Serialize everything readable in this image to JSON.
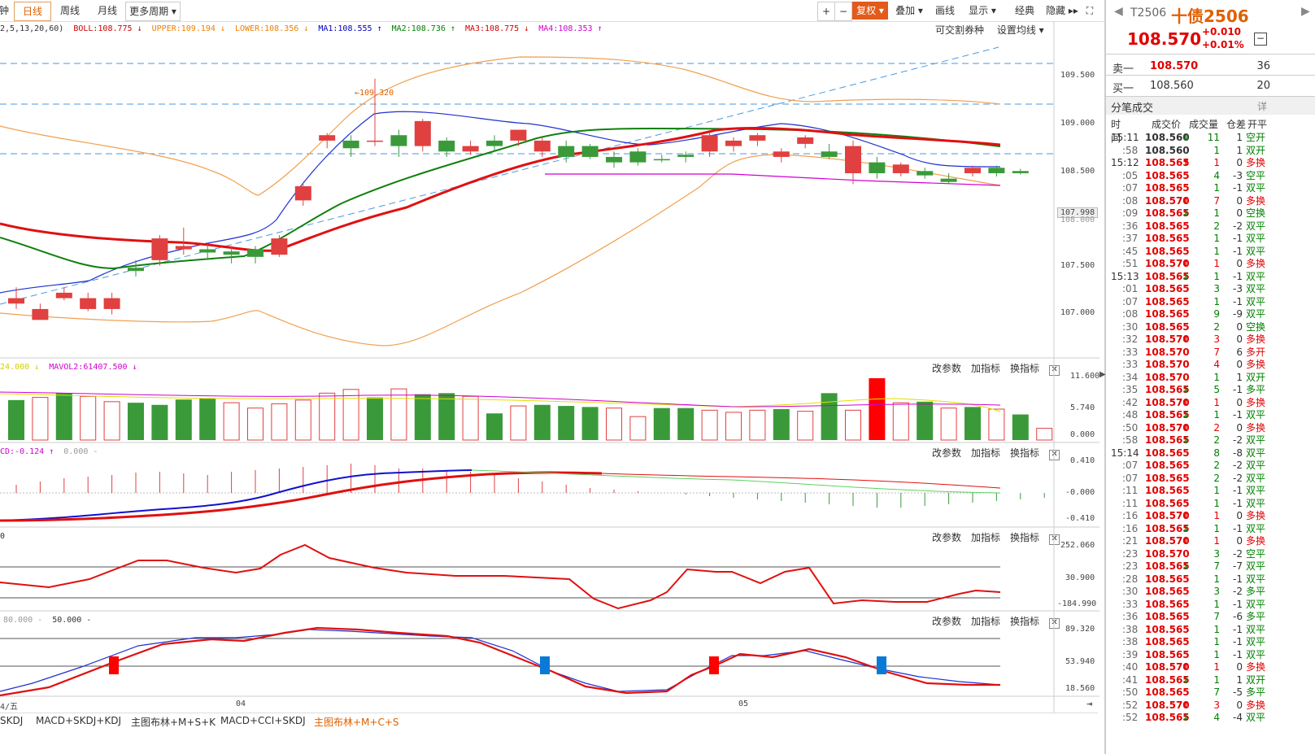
{
  "toolbar": {
    "tabs": [
      "钟",
      "日线",
      "周线",
      "月线",
      "更多周期 ▾"
    ],
    "active_tab": "日线",
    "right_buttons": [
      "+",
      "−",
      "复权 ▾",
      "叠加 ▾",
      "画线",
      "显示 ▾",
      "经典",
      "隐藏 ▸▸",
      "⛶"
    ]
  },
  "main_legend": {
    "params": "2,5,13,20,60)",
    "boll": "BOLL:108.775 ↓",
    "upper": "UPPER:109.194 ↓",
    "lower": "LOWER:108.356 ↓",
    "ma1": "MA1:108.555 ↑",
    "ma2": "MA2:108.736 ↑",
    "ma3": "MA3:108.775 ↓",
    "ma4": "MA4:108.353 ↑",
    "right1": "可交割券种",
    "right2": "设置均线 ▾"
  },
  "main_axis": [
    "109.500",
    "109.000",
    "108.500",
    "107.998",
    "108.000",
    "107.500",
    "107.000"
  ],
  "high_marker": "←109.320",
  "vol_legend": {
    "a": "24.000 ↓",
    "b": "MAVOL2:61407.500 ↓"
  },
  "vol_axis": [
    "11.600",
    "5.740",
    "0.000"
  ],
  "macd_legend": {
    "a": "CD:-0.124 ↑",
    "b": "0.000 -"
  },
  "macd_axis": [
    "0.410",
    "-0.000",
    "-0.410"
  ],
  "cci_legend": {
    "a": "0"
  },
  "cci_axis": [
    "252.060",
    "30.900",
    "-184.990"
  ],
  "kdj_legend": {
    "a": "80.000 -",
    "b": "50.000 -"
  },
  "kdj_axis": [
    "89.320",
    "53.940",
    "18.560"
  ],
  "sub_buttons": [
    "改参数",
    "加指标",
    "换指标"
  ],
  "date_labels": [
    "4/五",
    "04",
    "05"
  ],
  "bottom_tabs": [
    "SKDJ",
    "MACD+SKDJ+KDJ",
    "主图布林+M+S+K",
    "MACD+CCI+SKDJ",
    "主图布林+M+C+S"
  ],
  "active_bottom_tab": "主图布林+M+C+S",
  "quote": {
    "code": "T2506",
    "name": "十债2506",
    "price": "108.570",
    "change": "+0.010",
    "pct": "+0.01%",
    "sell_label": "卖一",
    "sell_price": "108.570",
    "sell_vol": "36",
    "buy_label": "买一",
    "buy_price": "108.560",
    "buy_vol": "20",
    "section": "分笔成交",
    "detail": "详",
    "headers": [
      "时间",
      "成交价",
      "成交量",
      "仓差",
      "开平"
    ]
  },
  "ticks": [
    [
      "15:11",
      "108.560",
      "↓",
      "11",
      "1",
      "空开",
      "g"
    ],
    [
      ":58",
      "108.560",
      "",
      "1",
      "1",
      "双开",
      "g"
    ],
    [
      "15:12",
      "108.565",
      "↑",
      "1",
      "0",
      "多换",
      "r"
    ],
    [
      ":05",
      "108.565",
      "",
      "4",
      "-3",
      "空平",
      "g"
    ],
    [
      ":07",
      "108.565",
      "",
      "1",
      "-1",
      "双平",
      "g"
    ],
    [
      ":08",
      "108.570",
      "↑",
      "7",
      "0",
      "多换",
      "r"
    ],
    [
      ":09",
      "108.565",
      "↓",
      "1",
      "0",
      "空换",
      "g"
    ],
    [
      ":36",
      "108.565",
      "",
      "2",
      "-2",
      "双平",
      "g"
    ],
    [
      ":37",
      "108.565",
      "",
      "1",
      "-1",
      "双平",
      "g"
    ],
    [
      ":45",
      "108.565",
      "",
      "1",
      "-1",
      "双平",
      "g"
    ],
    [
      ":51",
      "108.570",
      "↑",
      "1",
      "0",
      "多换",
      "r"
    ],
    [
      "15:13",
      "108.565",
      "↓",
      "1",
      "-1",
      "双平",
      "g"
    ],
    [
      ":01",
      "108.565",
      "",
      "3",
      "-3",
      "双平",
      "g"
    ],
    [
      ":07",
      "108.565",
      "",
      "1",
      "-1",
      "双平",
      "g"
    ],
    [
      ":08",
      "108.565",
      "",
      "9",
      "-9",
      "双平",
      "g"
    ],
    [
      ":30",
      "108.565",
      "",
      "2",
      "0",
      "空换",
      "g"
    ],
    [
      ":32",
      "108.570",
      "↑",
      "3",
      "0",
      "多换",
      "r"
    ],
    [
      ":33",
      "108.570",
      "",
      "7",
      "6",
      "多开",
      "r"
    ],
    [
      ":33",
      "108.570",
      "",
      "4",
      "0",
      "多换",
      "r"
    ],
    [
      ":34",
      "108.570",
      "",
      "1",
      "1",
      "双开",
      "g"
    ],
    [
      ":35",
      "108.565",
      "↓",
      "5",
      "-1",
      "多平",
      "g"
    ],
    [
      ":42",
      "108.570",
      "↑",
      "1",
      "0",
      "多换",
      "r"
    ],
    [
      ":48",
      "108.565",
      "↓",
      "1",
      "-1",
      "双平",
      "g"
    ],
    [
      ":50",
      "108.570",
      "↑",
      "2",
      "0",
      "多换",
      "r"
    ],
    [
      ":58",
      "108.565",
      "↓",
      "2",
      "-2",
      "双平",
      "g"
    ],
    [
      "15:14",
      "108.565",
      "",
      "8",
      "-8",
      "双平",
      "g"
    ],
    [
      ":07",
      "108.565",
      "",
      "2",
      "-2",
      "双平",
      "g"
    ],
    [
      ":07",
      "108.565",
      "",
      "2",
      "-2",
      "双平",
      "g"
    ],
    [
      ":11",
      "108.565",
      "",
      "1",
      "-1",
      "双平",
      "g"
    ],
    [
      ":11",
      "108.565",
      "",
      "1",
      "-1",
      "双平",
      "g"
    ],
    [
      ":16",
      "108.570",
      "↑",
      "1",
      "0",
      "多换",
      "r"
    ],
    [
      ":16",
      "108.565",
      "↓",
      "1",
      "-1",
      "双平",
      "g"
    ],
    [
      ":21",
      "108.570",
      "↑",
      "1",
      "0",
      "多换",
      "r"
    ],
    [
      ":23",
      "108.570",
      "",
      "3",
      "-2",
      "空平",
      "g"
    ],
    [
      ":23",
      "108.565",
      "↓",
      "7",
      "-7",
      "双平",
      "g"
    ],
    [
      ":28",
      "108.565",
      "",
      "1",
      "-1",
      "双平",
      "g"
    ],
    [
      ":30",
      "108.565",
      "",
      "3",
      "-2",
      "多平",
      "g"
    ],
    [
      ":33",
      "108.565",
      "",
      "1",
      "-1",
      "双平",
      "g"
    ],
    [
      ":36",
      "108.565",
      "",
      "7",
      "-6",
      "多平",
      "g"
    ],
    [
      ":38",
      "108.565",
      "",
      "1",
      "-1",
      "双平",
      "g"
    ],
    [
      ":38",
      "108.565",
      "",
      "1",
      "-1",
      "双平",
      "g"
    ],
    [
      ":39",
      "108.565",
      "",
      "1",
      "-1",
      "双平",
      "g"
    ],
    [
      ":40",
      "108.570",
      "↑",
      "1",
      "0",
      "多换",
      "r"
    ],
    [
      ":41",
      "108.565",
      "↓",
      "1",
      "1",
      "双开",
      "g"
    ],
    [
      ":50",
      "108.565",
      "",
      "7",
      "-5",
      "多平",
      "g"
    ],
    [
      ":52",
      "108.570",
      "↑",
      "3",
      "0",
      "多换",
      "r"
    ],
    [
      ":52",
      "108.565",
      "↓",
      "4",
      "-4",
      "双平",
      "g"
    ]
  ],
  "chart_data": [
    {
      "type": "candlestick",
      "title": "T2506 日线",
      "ylim": [
        106.9,
        109.7
      ],
      "candles": [
        [
          107.25,
          107.3,
          107.2,
          107.4
        ],
        [
          107.1,
          107.2,
          107.1,
          107.25
        ],
        [
          107.3,
          107.35,
          107.28,
          107.4
        ],
        [
          107.2,
          107.3,
          107.18,
          107.35
        ],
        [
          107.2,
          107.3,
          107.15,
          107.35
        ],
        [
          107.58,
          107.55,
          107.5,
          107.65
        ],
        [
          107.65,
          107.85,
          107.6,
          107.88
        ],
        [
          107.75,
          107.78,
          107.7,
          107.95
        ],
        [
          107.75,
          107.72,
          107.65,
          107.8
        ],
        [
          107.73,
          107.7,
          107.62,
          107.78
        ],
        [
          107.75,
          107.68,
          107.62,
          107.78
        ],
        [
          107.7,
          107.85,
          107.68,
          107.88
        ],
        [
          108.2,
          108.33,
          108.15,
          108.35
        ],
        [
          108.75,
          108.8,
          108.68,
          108.82
        ],
        [
          108.75,
          108.68,
          108.6,
          108.8
        ],
        [
          108.75,
          108.75,
          108.7,
          109.32
        ],
        [
          108.8,
          108.7,
          108.6,
          108.85
        ],
        [
          108.7,
          108.93,
          108.65,
          108.95
        ],
        [
          108.75,
          108.65,
          108.6,
          108.78
        ],
        [
          108.65,
          108.7,
          108.62,
          108.75
        ],
        [
          108.75,
          108.7,
          108.65,
          108.8
        ],
        [
          108.75,
          108.85,
          108.7,
          108.85
        ],
        [
          108.65,
          108.75,
          108.6,
          108.78
        ],
        [
          108.7,
          108.6,
          108.55,
          108.75
        ],
        [
          108.7,
          108.6,
          108.58,
          108.72
        ],
        [
          108.6,
          108.55,
          108.5,
          108.65
        ],
        [
          108.65,
          108.55,
          108.52,
          108.68
        ],
        [
          108.58,
          108.57,
          108.55,
          108.62
        ],
        [
          108.62,
          108.6,
          108.55,
          108.65
        ],
        [
          108.65,
          108.8,
          108.6,
          108.82
        ],
        [
          108.7,
          108.75,
          108.65,
          108.78
        ],
        [
          108.75,
          108.8,
          108.7,
          108.82
        ],
        [
          108.6,
          108.65,
          108.55,
          108.68
        ],
        [
          108.72,
          108.78,
          108.68,
          108.8
        ],
        [
          108.65,
          108.6,
          108.58,
          108.72
        ],
        [
          108.45,
          108.7,
          108.35,
          108.75
        ],
        [
          108.55,
          108.45,
          108.4,
          108.6
        ],
        [
          108.45,
          108.53,
          108.42,
          108.55
        ],
        [
          108.47,
          108.43,
          108.4,
          108.5
        ],
        [
          108.4,
          108.37,
          108.35,
          108.45
        ],
        [
          108.45,
          108.5,
          108.42,
          108.52
        ],
        [
          108.5,
          108.45,
          108.42,
          108.52
        ],
        [
          108.47,
          108.45,
          108.44,
          108.49
        ]
      ],
      "up_color": "#e04040",
      "down_color": "#3a9a3a"
    },
    {
      "type": "bar",
      "title": "VOL",
      "ylim": [
        0,
        11.6
      ],
      "values": [
        7.5,
        8.0,
        8.8,
        8.2,
        7.2,
        7.0,
        6.6,
        7.6,
        7.8,
        7.0,
        6.0,
        6.8,
        7.5,
        8.8,
        9.5,
        8.0,
        9.6,
        8.6,
        8.8,
        8.2,
        5.0,
        6.4,
        6.6,
        6.4,
        6.2,
        6.0,
        4.4,
        6.0,
        6.0,
        5.6,
        5.2,
        5.6,
        5.8,
        5.4,
        8.8,
        5.6,
        11.6,
        7.0,
        7.2,
        6.0,
        6.2,
        5.8,
        4.8,
        2.2
      ],
      "filled": [
        1,
        0,
        1,
        0,
        0,
        1,
        1,
        1,
        1,
        0,
        0,
        0,
        0,
        0,
        0,
        1,
        0,
        1,
        1,
        0,
        1,
        0,
        1,
        1,
        1,
        0,
        0,
        1,
        1,
        0,
        0,
        0,
        1,
        0,
        1,
        0,
        2,
        0,
        1,
        0,
        1,
        0,
        1,
        0
      ]
    },
    {
      "type": "line",
      "title": "MACD",
      "ylim": [
        -0.41,
        0.41
      ]
    },
    {
      "type": "line",
      "title": "CCI",
      "ylim": [
        -184.99,
        252.06
      ]
    },
    {
      "type": "line",
      "title": "KDJ",
      "ylim": [
        18.56,
        89.32
      ]
    }
  ]
}
